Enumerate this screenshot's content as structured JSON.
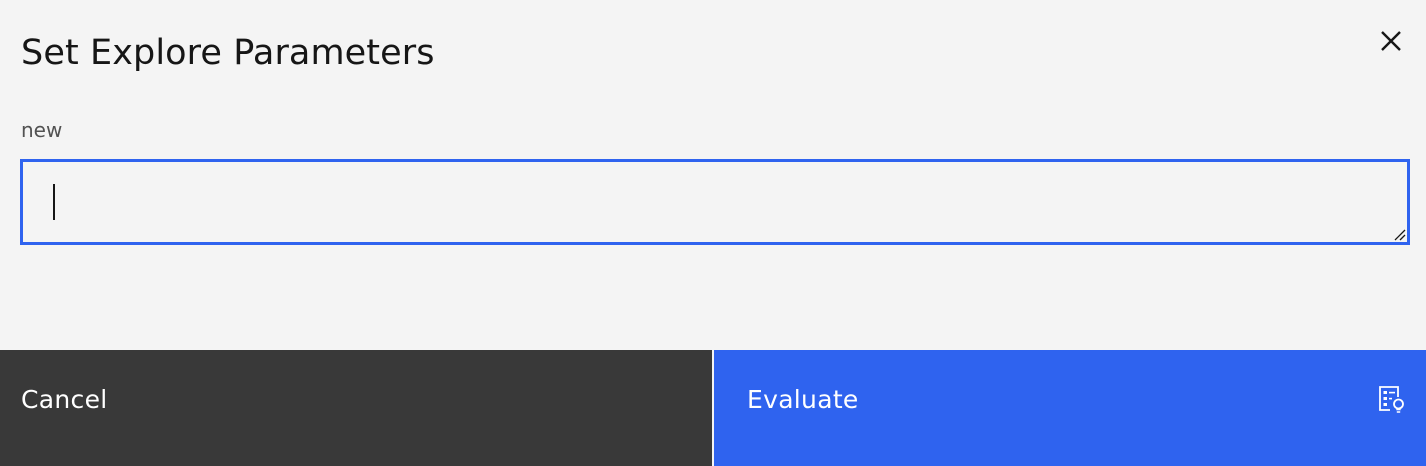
{
  "dialog": {
    "title": "Set Explore Parameters",
    "close_icon": "close-icon",
    "field": {
      "label": "new",
      "value": "",
      "placeholder": ""
    },
    "buttons": {
      "cancel_label": "Cancel",
      "evaluate_label": "Evaluate",
      "evaluate_icon": "report-lightbulb-icon"
    }
  },
  "colors": {
    "background": "#f4f4f4",
    "focus_border": "#2f63ef",
    "secondary_button": "#393939",
    "primary_button": "#2f63ef",
    "text": "#161616",
    "label": "#525252"
  }
}
